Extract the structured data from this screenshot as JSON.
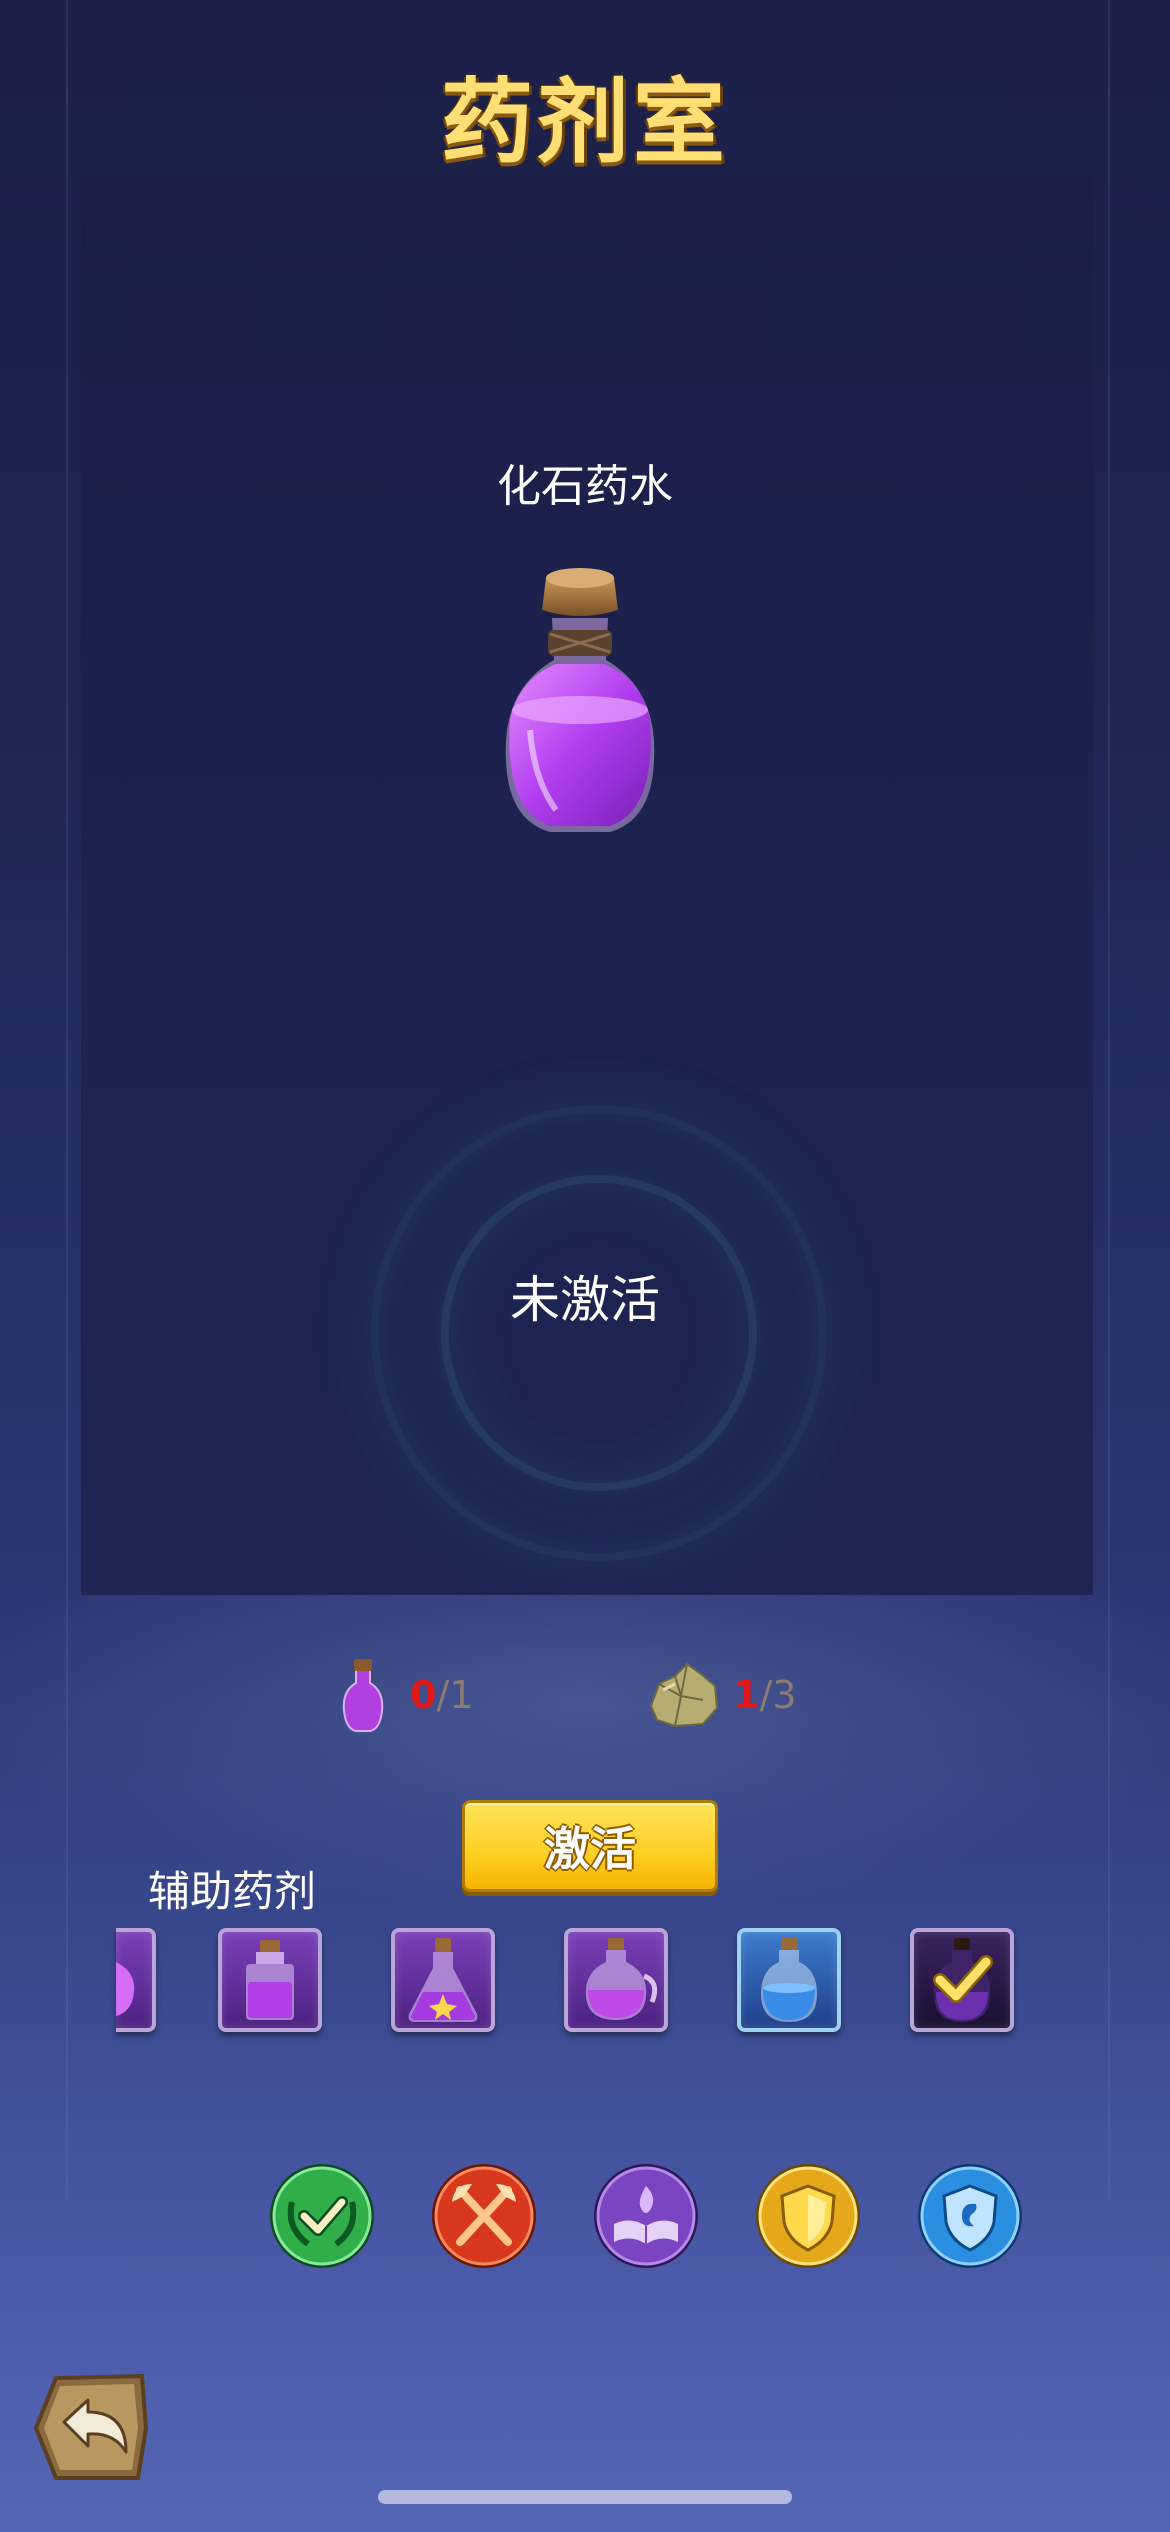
{
  "title": "药剂室",
  "selected_potion": {
    "name": "化石药水",
    "icon": "purple-potion-bottle",
    "status": "未激活"
  },
  "requirements": [
    {
      "icon": "small-purple-potion-icon",
      "have": "0",
      "separator": "/",
      "need": "1"
    },
    {
      "icon": "fossil-ore-icon",
      "have": "1",
      "separator": "/",
      "need": "3"
    }
  ],
  "activate_button": {
    "label": "激活"
  },
  "aux_section": {
    "label": "辅助药剂",
    "slots": [
      {
        "icon": "purple-potion-partial",
        "selected": false
      },
      {
        "icon": "purple-square-bottle",
        "selected": false
      },
      {
        "icon": "gold-sparkle-flask",
        "selected": false
      },
      {
        "icon": "purple-jug-potion",
        "selected": false
      },
      {
        "icon": "blue-potion-bottle",
        "selected": false
      },
      {
        "icon": "dark-potion-checked",
        "selected": true
      }
    ]
  },
  "categories": [
    {
      "icon": "green-check-wreath-icon",
      "color": "#2fae4a"
    },
    {
      "icon": "red-crossed-axes-icon",
      "color": "#d8391d"
    },
    {
      "icon": "purple-spellbook-icon",
      "color": "#7b44c2"
    },
    {
      "icon": "gold-shield-icon",
      "color": "#e5a81b"
    },
    {
      "icon": "blue-shield-icon",
      "color": "#2a8fe0"
    }
  ],
  "back_button": {
    "icon": "back-arrow-icon"
  }
}
